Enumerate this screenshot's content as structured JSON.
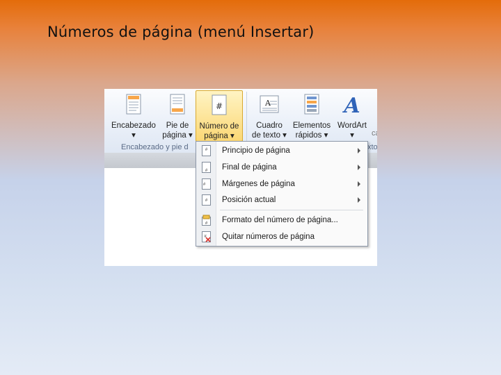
{
  "slide": {
    "title": "Números de página (menú Insertar)"
  },
  "ribbon": {
    "buttons": [
      {
        "label1": "Encabezado",
        "label2": "▾"
      },
      {
        "label1": "Pie de",
        "label2": "página ▾"
      },
      {
        "label1": "Número de",
        "label2": "página ▾"
      },
      {
        "label1": "Cuadro",
        "label2": "de texto ▾"
      },
      {
        "label1": "Elementos",
        "label2": "rápidos ▾"
      },
      {
        "label1": "WordArt",
        "label2": "▾"
      }
    ],
    "group_label_left": "Encabezado y pie d",
    "group_label_right": "xto",
    "partial_right_label": "ca"
  },
  "menu": {
    "items": [
      {
        "label": "Principio de página",
        "has_submenu": true
      },
      {
        "label": "Final de página",
        "has_submenu": true
      },
      {
        "label": "Márgenes de página",
        "has_submenu": true
      },
      {
        "label": "Posición actual",
        "has_submenu": true
      },
      {
        "label": "Formato del número de página...",
        "has_submenu": false
      },
      {
        "label": "Quitar números de página",
        "has_submenu": false
      }
    ]
  },
  "colors": {
    "title_gradient_top": "#e46c0a",
    "background_bottom": "#e4ebf6",
    "active_button": "#fbd774"
  }
}
